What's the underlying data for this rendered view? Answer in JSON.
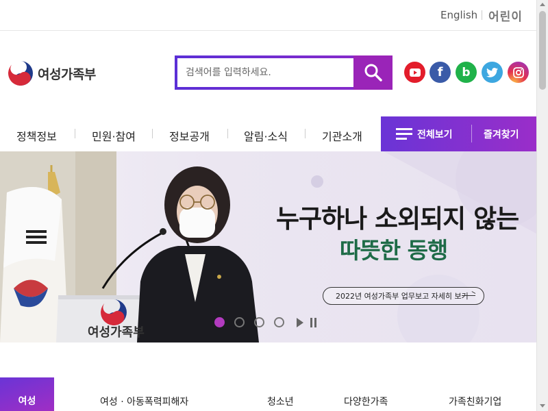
{
  "topbar": {
    "english_label": "English",
    "kids_label": "어린이"
  },
  "header": {
    "site_name": "여성가족부"
  },
  "search": {
    "placeholder": "검색어를 입력하세요."
  },
  "social": [
    "youtube-icon",
    "facebook-icon",
    "blog-icon",
    "twitter-icon",
    "instagram-icon"
  ],
  "nav": {
    "items": [
      "정책정보",
      "민원·참여",
      "정보공개",
      "알림·소식",
      "기관소개"
    ],
    "all_menu_label": "전체보기",
    "favorites_label": "즐겨찾기"
  },
  "hero": {
    "headline_line1": "누구하나 소외되지 않는",
    "headline_line2": "따뜻한 동행",
    "more_label": "2022년 여성가족부 업무보고 자세히 보기",
    "podium_text": "여성가족부",
    "slide_count": 4,
    "active_slide": 1
  },
  "tabs": {
    "active": "여성",
    "items": [
      "여성 · 아동폭력피해자",
      "청소년",
      "다양한가족",
      "가족친화기업"
    ]
  },
  "colors": {
    "accent_start": "#6a34d6",
    "accent_end": "#9a2ec9",
    "headline_green": "#1e6b47"
  }
}
